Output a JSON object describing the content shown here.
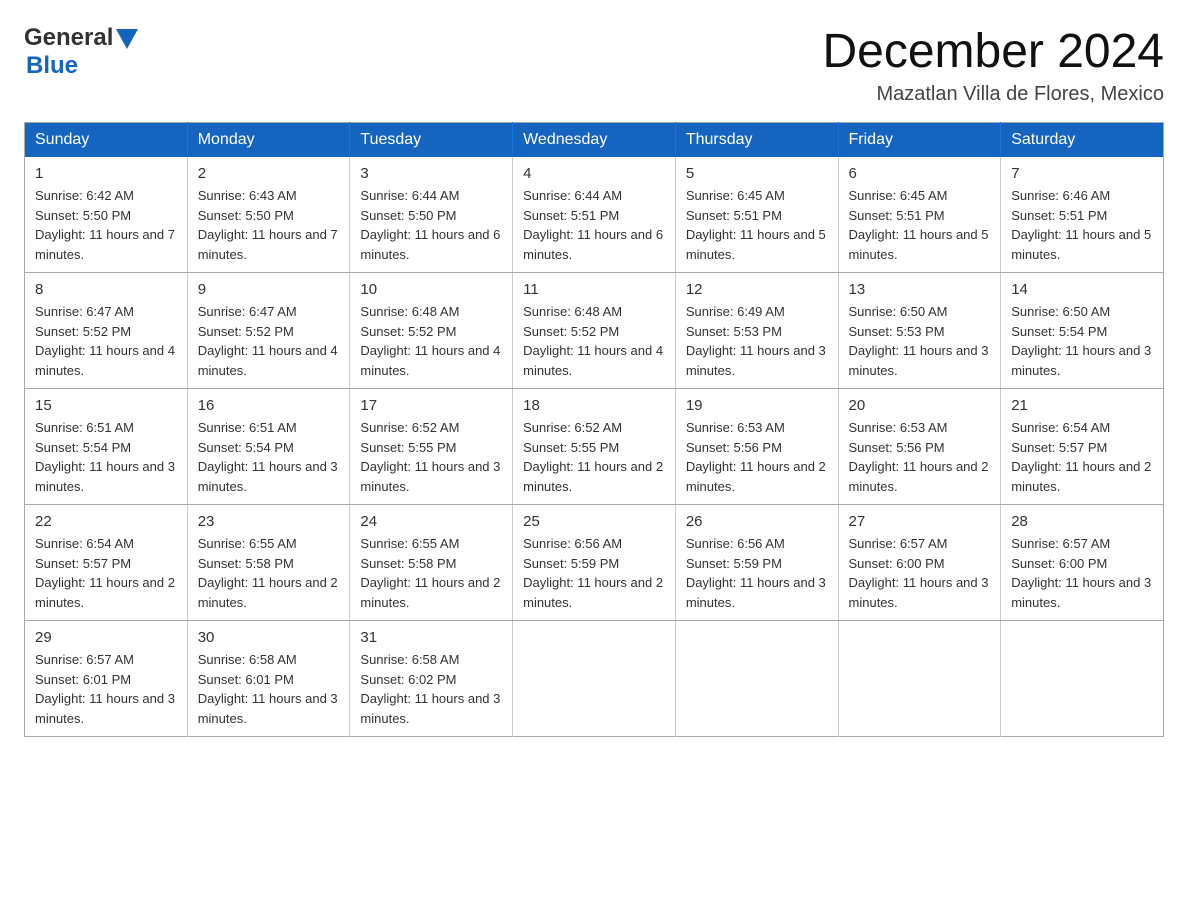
{
  "header": {
    "logo_general": "General",
    "logo_blue": "Blue",
    "title": "December 2024",
    "subtitle": "Mazatlan Villa de Flores, Mexico"
  },
  "weekdays": [
    "Sunday",
    "Monday",
    "Tuesday",
    "Wednesday",
    "Thursday",
    "Friday",
    "Saturday"
  ],
  "weeks": [
    [
      {
        "day": "1",
        "sunrise": "6:42 AM",
        "sunset": "5:50 PM",
        "daylight": "11 hours and 7 minutes."
      },
      {
        "day": "2",
        "sunrise": "6:43 AM",
        "sunset": "5:50 PM",
        "daylight": "11 hours and 7 minutes."
      },
      {
        "day": "3",
        "sunrise": "6:44 AM",
        "sunset": "5:50 PM",
        "daylight": "11 hours and 6 minutes."
      },
      {
        "day": "4",
        "sunrise": "6:44 AM",
        "sunset": "5:51 PM",
        "daylight": "11 hours and 6 minutes."
      },
      {
        "day": "5",
        "sunrise": "6:45 AM",
        "sunset": "5:51 PM",
        "daylight": "11 hours and 5 minutes."
      },
      {
        "day": "6",
        "sunrise": "6:45 AM",
        "sunset": "5:51 PM",
        "daylight": "11 hours and 5 minutes."
      },
      {
        "day": "7",
        "sunrise": "6:46 AM",
        "sunset": "5:51 PM",
        "daylight": "11 hours and 5 minutes."
      }
    ],
    [
      {
        "day": "8",
        "sunrise": "6:47 AM",
        "sunset": "5:52 PM",
        "daylight": "11 hours and 4 minutes."
      },
      {
        "day": "9",
        "sunrise": "6:47 AM",
        "sunset": "5:52 PM",
        "daylight": "11 hours and 4 minutes."
      },
      {
        "day": "10",
        "sunrise": "6:48 AM",
        "sunset": "5:52 PM",
        "daylight": "11 hours and 4 minutes."
      },
      {
        "day": "11",
        "sunrise": "6:48 AM",
        "sunset": "5:52 PM",
        "daylight": "11 hours and 4 minutes."
      },
      {
        "day": "12",
        "sunrise": "6:49 AM",
        "sunset": "5:53 PM",
        "daylight": "11 hours and 3 minutes."
      },
      {
        "day": "13",
        "sunrise": "6:50 AM",
        "sunset": "5:53 PM",
        "daylight": "11 hours and 3 minutes."
      },
      {
        "day": "14",
        "sunrise": "6:50 AM",
        "sunset": "5:54 PM",
        "daylight": "11 hours and 3 minutes."
      }
    ],
    [
      {
        "day": "15",
        "sunrise": "6:51 AM",
        "sunset": "5:54 PM",
        "daylight": "11 hours and 3 minutes."
      },
      {
        "day": "16",
        "sunrise": "6:51 AM",
        "sunset": "5:54 PM",
        "daylight": "11 hours and 3 minutes."
      },
      {
        "day": "17",
        "sunrise": "6:52 AM",
        "sunset": "5:55 PM",
        "daylight": "11 hours and 3 minutes."
      },
      {
        "day": "18",
        "sunrise": "6:52 AM",
        "sunset": "5:55 PM",
        "daylight": "11 hours and 2 minutes."
      },
      {
        "day": "19",
        "sunrise": "6:53 AM",
        "sunset": "5:56 PM",
        "daylight": "11 hours and 2 minutes."
      },
      {
        "day": "20",
        "sunrise": "6:53 AM",
        "sunset": "5:56 PM",
        "daylight": "11 hours and 2 minutes."
      },
      {
        "day": "21",
        "sunrise": "6:54 AM",
        "sunset": "5:57 PM",
        "daylight": "11 hours and 2 minutes."
      }
    ],
    [
      {
        "day": "22",
        "sunrise": "6:54 AM",
        "sunset": "5:57 PM",
        "daylight": "11 hours and 2 minutes."
      },
      {
        "day": "23",
        "sunrise": "6:55 AM",
        "sunset": "5:58 PM",
        "daylight": "11 hours and 2 minutes."
      },
      {
        "day": "24",
        "sunrise": "6:55 AM",
        "sunset": "5:58 PM",
        "daylight": "11 hours and 2 minutes."
      },
      {
        "day": "25",
        "sunrise": "6:56 AM",
        "sunset": "5:59 PM",
        "daylight": "11 hours and 2 minutes."
      },
      {
        "day": "26",
        "sunrise": "6:56 AM",
        "sunset": "5:59 PM",
        "daylight": "11 hours and 3 minutes."
      },
      {
        "day": "27",
        "sunrise": "6:57 AM",
        "sunset": "6:00 PM",
        "daylight": "11 hours and 3 minutes."
      },
      {
        "day": "28",
        "sunrise": "6:57 AM",
        "sunset": "6:00 PM",
        "daylight": "11 hours and 3 minutes."
      }
    ],
    [
      {
        "day": "29",
        "sunrise": "6:57 AM",
        "sunset": "6:01 PM",
        "daylight": "11 hours and 3 minutes."
      },
      {
        "day": "30",
        "sunrise": "6:58 AM",
        "sunset": "6:01 PM",
        "daylight": "11 hours and 3 minutes."
      },
      {
        "day": "31",
        "sunrise": "6:58 AM",
        "sunset": "6:02 PM",
        "daylight": "11 hours and 3 minutes."
      },
      null,
      null,
      null,
      null
    ]
  ],
  "labels": {
    "sunrise": "Sunrise: ",
    "sunset": "Sunset: ",
    "daylight": "Daylight: "
  },
  "colors": {
    "header_bg": "#1565c0",
    "header_text": "#ffffff",
    "border": "#aaaaaa",
    "cell_border": "#cccccc",
    "logo_blue": "#1565c0",
    "logo_dark": "#333333"
  }
}
